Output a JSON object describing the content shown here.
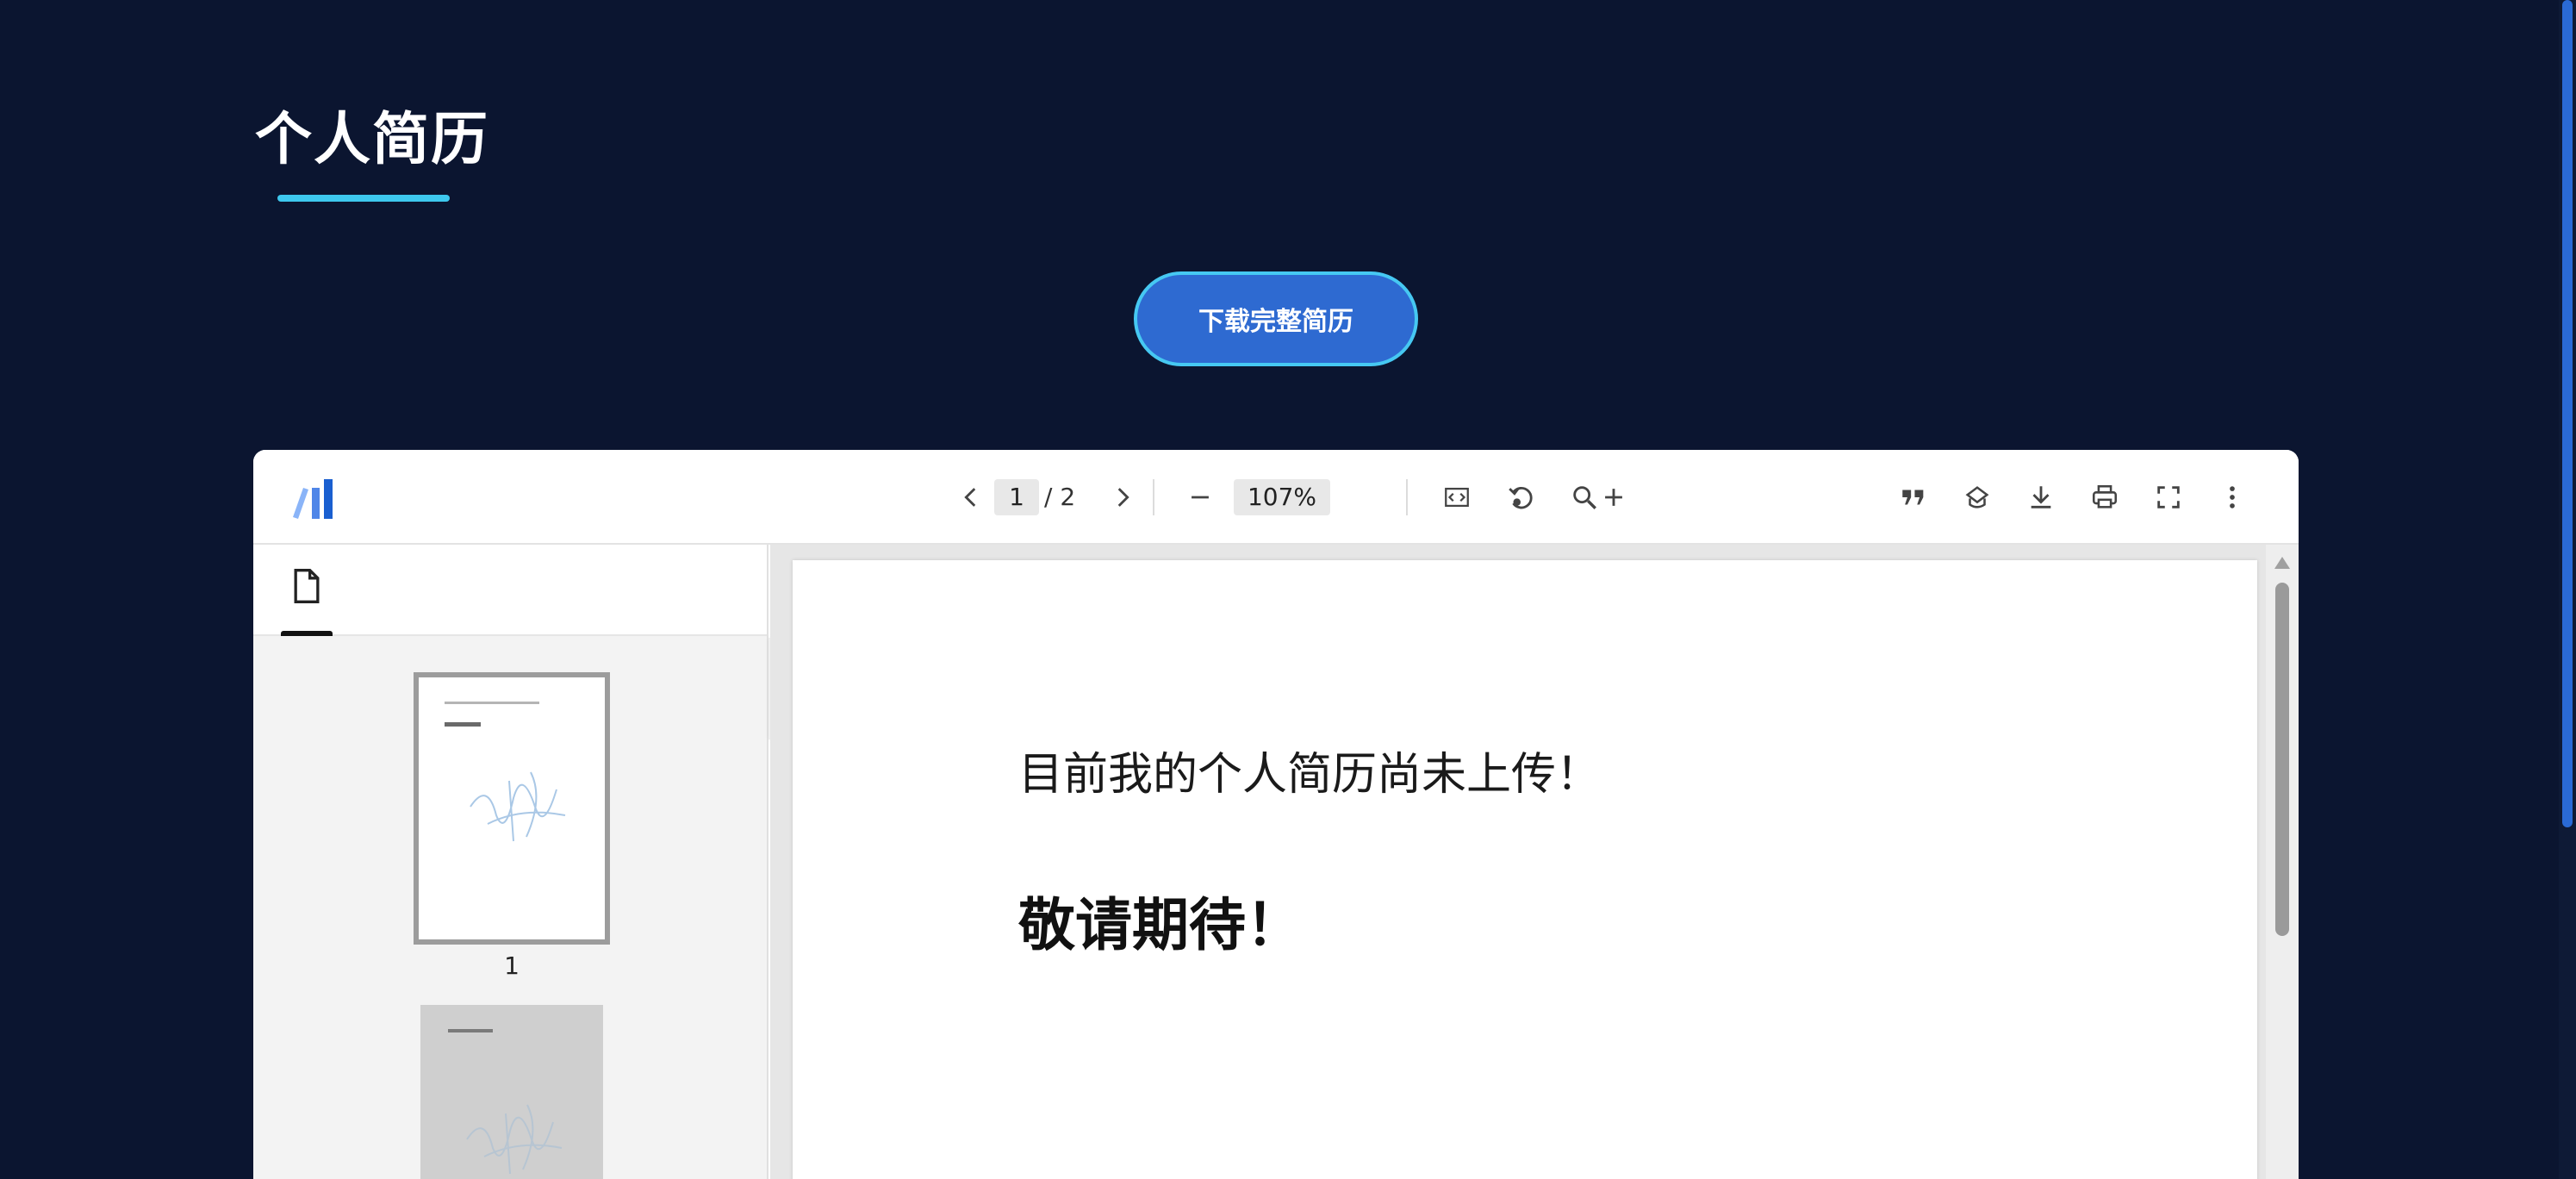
{
  "header": {
    "title": "个人简历",
    "download_label": "下载完整简历"
  },
  "viewer": {
    "toolbar": {
      "current_page": "1",
      "total_pages": "/ 2",
      "zoom": "107%",
      "icons": [
        "app-logo",
        "prev-page",
        "next-page",
        "zoom-out",
        "zoom-in",
        "fit-width",
        "rotate",
        "search",
        "quote",
        "annotate",
        "download",
        "print",
        "fullscreen",
        "more"
      ]
    },
    "sidebar": {
      "thumbnails": [
        {
          "page_label": "1",
          "selected": true
        },
        {
          "page_label": "",
          "selected": false
        }
      ]
    },
    "document": {
      "line1": "目前我的个人简历尚未上传！",
      "line2": "敬请期待！"
    }
  },
  "colors": {
    "background": "#0b1530",
    "accent": "#3ec8ee",
    "button": "#2e6ad1"
  }
}
